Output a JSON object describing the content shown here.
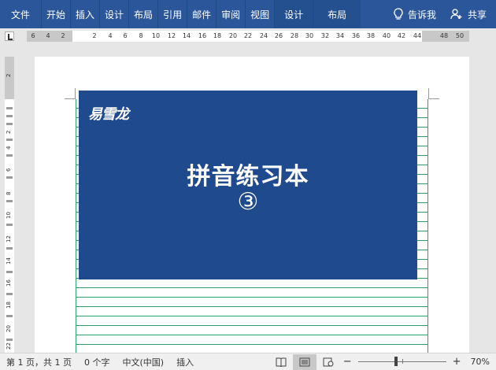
{
  "ribbon": {
    "file": "文件",
    "tabs": [
      "开始",
      "插入",
      "设计",
      "布局",
      "引用",
      "邮件",
      "审阅",
      "视图"
    ],
    "context_tabs": [
      "设计",
      "布局"
    ],
    "tell_me": "告诉我",
    "share": "共享",
    "icons": [
      "lightbulb-icon",
      "person-add-icon"
    ]
  },
  "ruler": {
    "left_labels": [
      "6",
      "4",
      "2"
    ],
    "labels": [
      "2",
      "4",
      "6",
      "8",
      "10",
      "12",
      "14",
      "16",
      "18",
      "20",
      "22",
      "24",
      "26",
      "28",
      "30",
      "32",
      "34",
      "36",
      "38",
      "40",
      "42",
      "44"
    ],
    "right_labels": [
      "48",
      "50"
    ],
    "vertical_labels": [
      "2",
      "2",
      "4",
      "6",
      "8",
      "10",
      "12",
      "14",
      "16",
      "18",
      "20",
      "22",
      "24"
    ]
  },
  "document": {
    "brand": "易雪龙",
    "title": "拼音练习本",
    "number": "③"
  },
  "status": {
    "page": "第 1 页，共 1 页",
    "words": "0 个字",
    "language": "中文(中国)",
    "mode": "插入",
    "zoom": "70%",
    "zoom_minus": "−",
    "zoom_plus": "+"
  }
}
